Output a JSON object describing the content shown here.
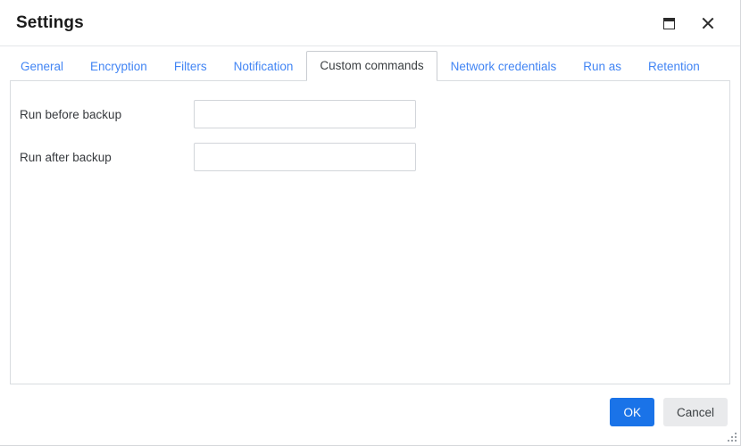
{
  "window": {
    "title": "Settings",
    "controls": [
      {
        "name": "maximize-button",
        "icon": "maximize-icon",
        "label": "Maximize"
      },
      {
        "name": "close-button",
        "icon": "close-icon",
        "label": "Close"
      }
    ]
  },
  "tabs": {
    "active_index": 4,
    "items": [
      {
        "label": "General"
      },
      {
        "label": "Encryption"
      },
      {
        "label": "Filters"
      },
      {
        "label": "Notification"
      },
      {
        "label": "Custom commands"
      },
      {
        "label": "Network credentials"
      },
      {
        "label": "Run as"
      },
      {
        "label": "Retention"
      }
    ]
  },
  "form": {
    "fields": [
      {
        "label": "Run before backup",
        "value": "",
        "placeholder": ""
      },
      {
        "label": "Run after backup",
        "value": "",
        "placeholder": ""
      }
    ]
  },
  "footer": {
    "ok_label": "OK",
    "cancel_label": "Cancel"
  },
  "colors": {
    "accent": "#1a73e8",
    "tab_link": "#4285f4",
    "text": "#3c4043",
    "border": "#d9dce0",
    "secondary_button": "#e9eaec"
  }
}
